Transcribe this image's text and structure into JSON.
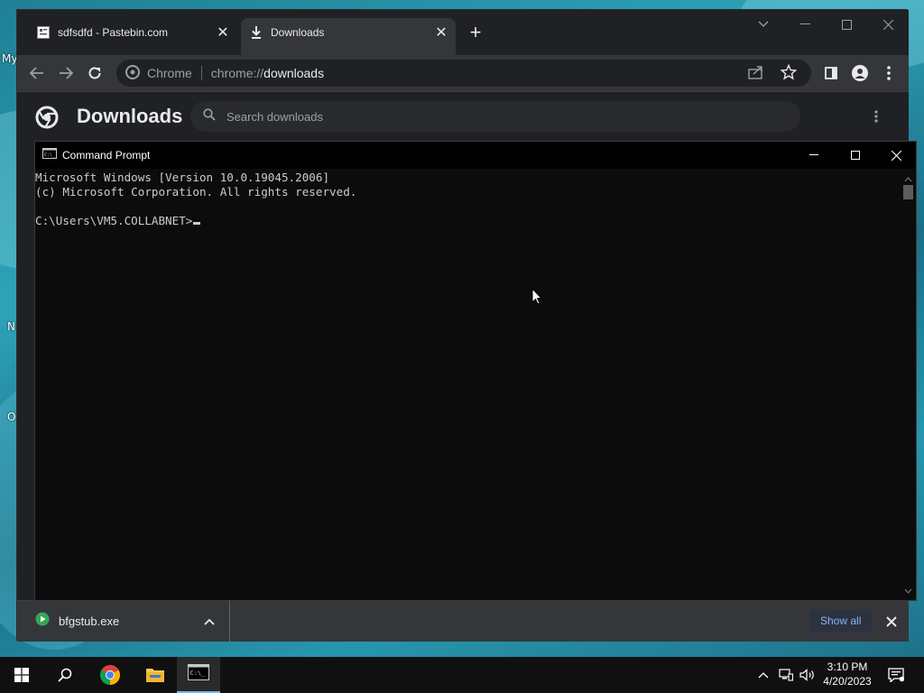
{
  "desktop": {
    "icon_labels": [
      "My",
      "N",
      "O"
    ]
  },
  "chrome": {
    "tabs": [
      {
        "title": "sdfsdfd - Pastebin.com",
        "favicon": "pastebin-icon",
        "active": false
      },
      {
        "title": "Downloads",
        "favicon": "download-icon",
        "active": true
      }
    ],
    "omnibox": {
      "chip": "Chrome",
      "url_prefix": "chrome://",
      "url_main": "downloads"
    },
    "page": {
      "title": "Downloads",
      "search_placeholder": "Search downloads"
    },
    "shelf": {
      "file_name": "bfgstub.exe",
      "show_all_label": "Show all"
    }
  },
  "cmd": {
    "title": "Command Prompt",
    "lines": [
      "Microsoft Windows [Version 10.0.19045.2006]",
      "(c) Microsoft Corporation. All rights reserved.",
      "",
      "C:\\Users\\VM5.COLLABNET>"
    ]
  },
  "taskbar": {
    "time": "3:10 PM",
    "date": "4/20/2023",
    "pinned": [
      "windows-start-icon",
      "search-icon",
      "chrome-icon",
      "file-explorer-icon",
      "command-prompt-icon"
    ]
  },
  "colors": {
    "chrome_bg": "#202124",
    "chrome_toolbar": "#35363a",
    "cmd_bg": "#0c0c0c",
    "cmd_text": "#cccccc",
    "link_blue": "#8ab4f8",
    "taskbar": "#101010",
    "taskbar_accent": "#76b9ed"
  }
}
